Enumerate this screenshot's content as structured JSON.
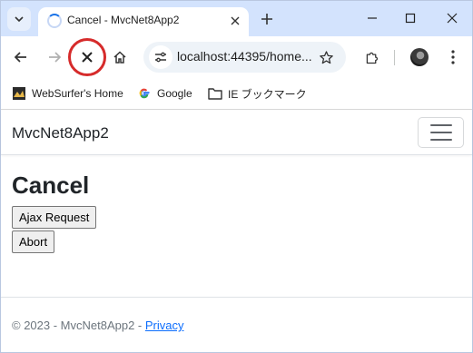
{
  "browser": {
    "tab": {
      "title": "Cancel - MvcNet8App2"
    },
    "address": {
      "url": "localhost:44395/home..."
    },
    "bookmarks": [
      {
        "label": "WebSurfer's Home",
        "icon": "websurfer-favicon"
      },
      {
        "label": "Google",
        "icon": "google-g-icon"
      },
      {
        "label": "IE ブックマーク",
        "icon": "folder-icon"
      }
    ],
    "colors": {
      "tab_strip": "#d3e3fd",
      "annotation_circle": "#d62b2b"
    }
  },
  "page": {
    "brand": "MvcNet8App2",
    "heading": "Cancel",
    "buttons": {
      "ajax": "Ajax Request",
      "abort": "Abort"
    },
    "footer": {
      "copyright": "© 2023 - MvcNet8App2 - ",
      "privacy_link": "Privacy"
    },
    "colors": {
      "link": "#0d6efd",
      "footer_text": "#6c757d"
    }
  }
}
